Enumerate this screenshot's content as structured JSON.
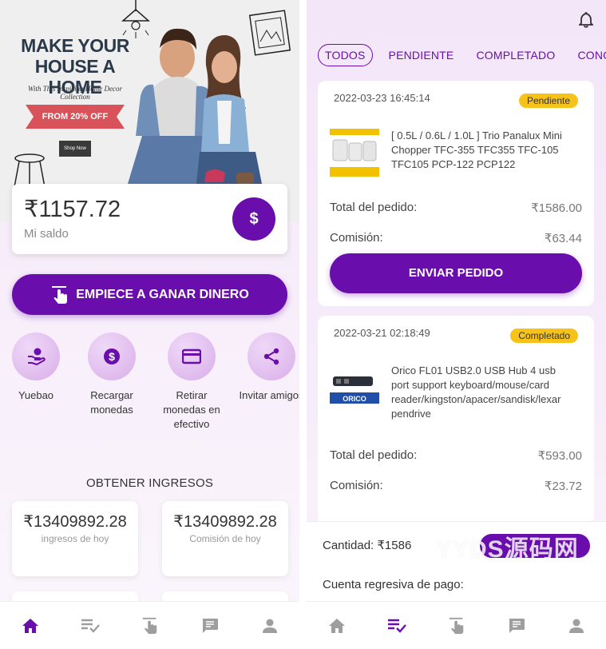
{
  "colors": {
    "accent": "#6a0dad",
    "badge": "#f7c21a",
    "tab_active": "#6a0dad",
    "tab_inactive": "#9e9e9e"
  },
  "left": {
    "banner": {
      "title": "MAKE YOUR HOUSE A HOME",
      "subtitle": "With This Inspiring Home Decor Collection",
      "offer": "FROM 20% OFF",
      "shop": "Shop Now"
    },
    "balance": {
      "amount": "₹1157.72",
      "label": "Mi saldo",
      "icon": "$"
    },
    "earn_button": "EMPIECE A GANAR DINERO",
    "actions": [
      {
        "icon": "yuebao-icon",
        "label": "Yuebao"
      },
      {
        "icon": "recharge-coin-icon",
        "label": "Recargar monedas"
      },
      {
        "icon": "card-icon",
        "label": "Retirar monedas en efectivo"
      },
      {
        "icon": "share-icon",
        "label": "Invitar amigos"
      }
    ],
    "income_title": "OBTENER INGRESOS",
    "stats": [
      {
        "value": "₹13409892.28",
        "label": "ingresos de hoy"
      },
      {
        "value": "₹13409892.28",
        "label": "Comisión de hoy"
      }
    ],
    "tabbar": [
      "home-icon",
      "order-list-icon",
      "grab-order-icon",
      "messages-icon",
      "profile-icon"
    ],
    "tabbar_active": 0
  },
  "right": {
    "filter_tabs": [
      "TODOS",
      "PENDIENTE",
      "COMPLETADO",
      "CONGELANI"
    ],
    "active_filter": 0,
    "orders": [
      {
        "date": "2022-03-23 16:45:14",
        "status": "Pendiente",
        "name": "[ 0.5L / 0.6L / 1.0L ] Trio Panalux Mini Chopper TFC-355 TFC355 TFC-105 TFC105 PCP-122 PCP122",
        "total_label": "Total del pedido:",
        "total": "₹1586.00",
        "commission_label": "Comisión:",
        "commission": "₹63.44",
        "button": "ENVIAR PEDIDO"
      },
      {
        "date": "2022-03-21 02:18:49",
        "status": "Completado",
        "name": "Orico FL01 USB2.0 USB Hub 4 usb port support keyboard/mouse/card reader/kingston/apacer/sandisk/lexar pendrive",
        "total_label": "Total del pedido:",
        "total": "₹593.00",
        "commission_label": "Comisión:",
        "commission": "₹23.72"
      }
    ],
    "quantity_label": "Cantidad:",
    "quantity_value": "₹1586",
    "countdown_label": "Cuenta regresiva de pago:",
    "watermark": "YYDS源码网",
    "tabbar_active": 1
  }
}
